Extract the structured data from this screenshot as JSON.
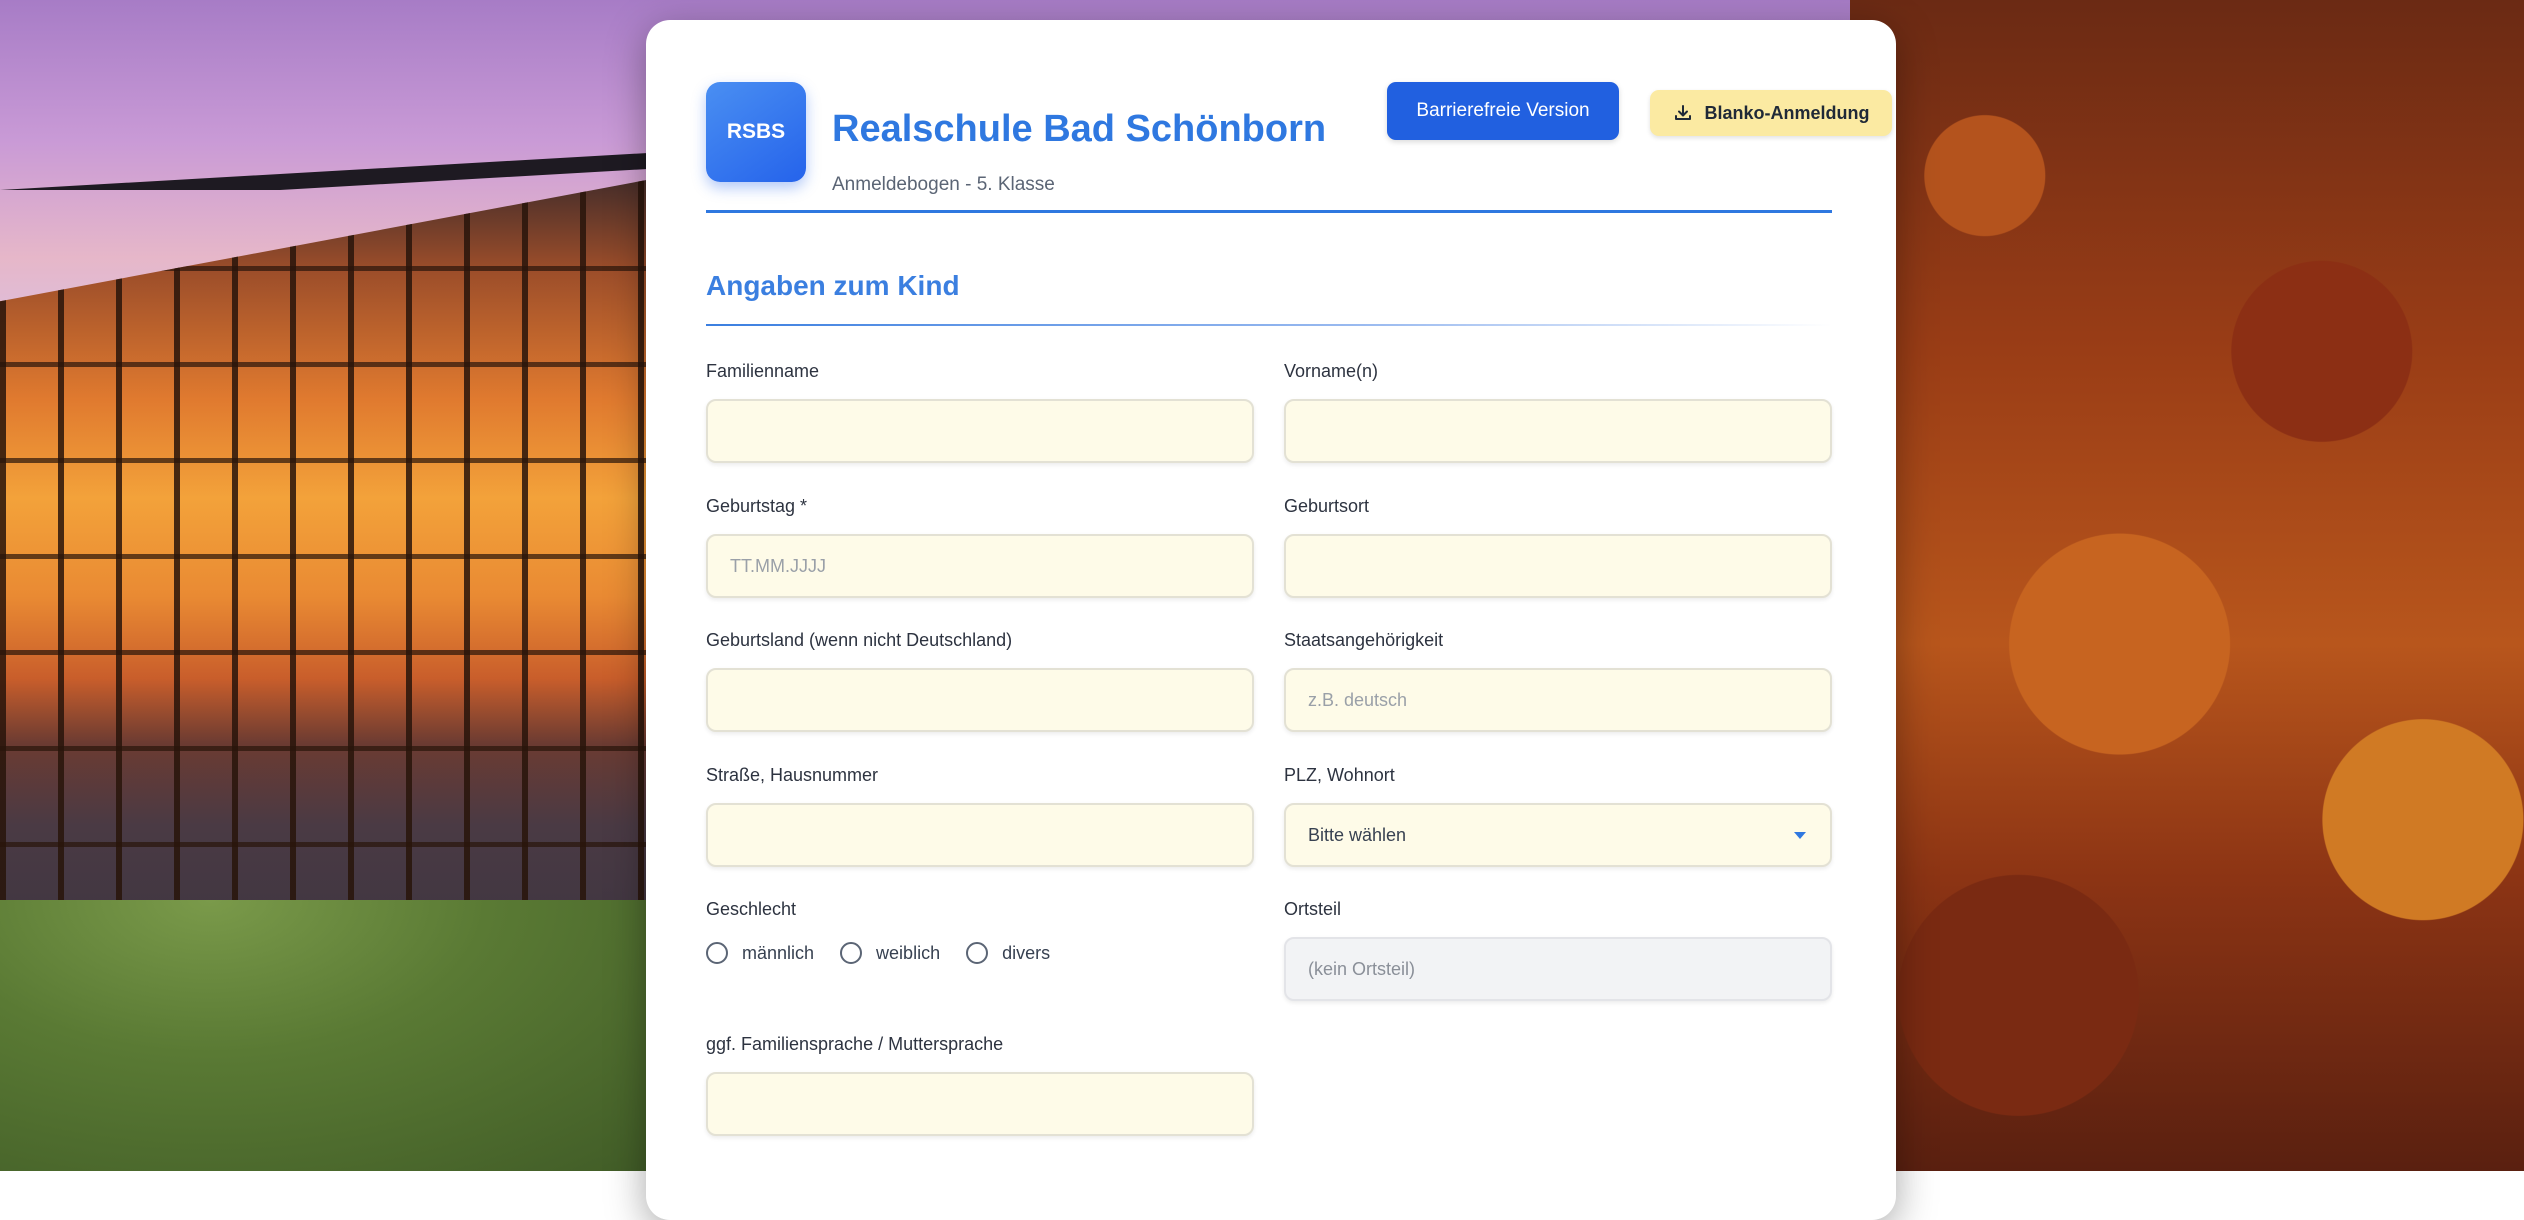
{
  "header": {
    "logo_text": "RSBS",
    "title": "Realschule Bad Schönborn",
    "subtitle": "Anmeldebogen - 5. Klasse",
    "accessible_button": "Barrierefreie Version",
    "blank_button": "Blanko-Anmeldung"
  },
  "section": {
    "title": "Angaben zum Kind"
  },
  "fields": {
    "familienname": {
      "label": "Familienname",
      "value": "",
      "placeholder": ""
    },
    "vorname": {
      "label": "Vorname(n)",
      "value": "",
      "placeholder": ""
    },
    "geburtstag": {
      "label": "Geburtstag *",
      "value": "",
      "placeholder": "TT.MM.JJJJ"
    },
    "geburtsort": {
      "label": "Geburtsort",
      "value": "",
      "placeholder": ""
    },
    "geburtsland": {
      "label": "Geburtsland (wenn nicht Deutschland)",
      "value": "",
      "placeholder": ""
    },
    "staatsangehoerigkeit": {
      "label": "Staatsangehörigkeit",
      "value": "",
      "placeholder": "z.B. deutsch"
    },
    "strasse": {
      "label": "Straße, Hausnummer",
      "value": "",
      "placeholder": ""
    },
    "plz_wohnort": {
      "label": "PLZ, Wohnort",
      "selected": "Bitte wählen"
    },
    "geschlecht": {
      "label": "Geschlecht",
      "options": [
        "männlich",
        "weiblich",
        "divers"
      ]
    },
    "ortsteil": {
      "label": "Ortsteil",
      "placeholder": "(kein Ortsteil)"
    },
    "familiensprache": {
      "label": "ggf. Familiensprache / Muttersprache",
      "value": "",
      "placeholder": ""
    }
  },
  "icons": {
    "download": "download-icon",
    "select_arrow": "chevron-down-icon"
  },
  "colors": {
    "accent": "#2f78e0",
    "button_primary": "#2160e0",
    "button_secondary": "#fbeaa2",
    "input_bg": "#fefbe8"
  }
}
